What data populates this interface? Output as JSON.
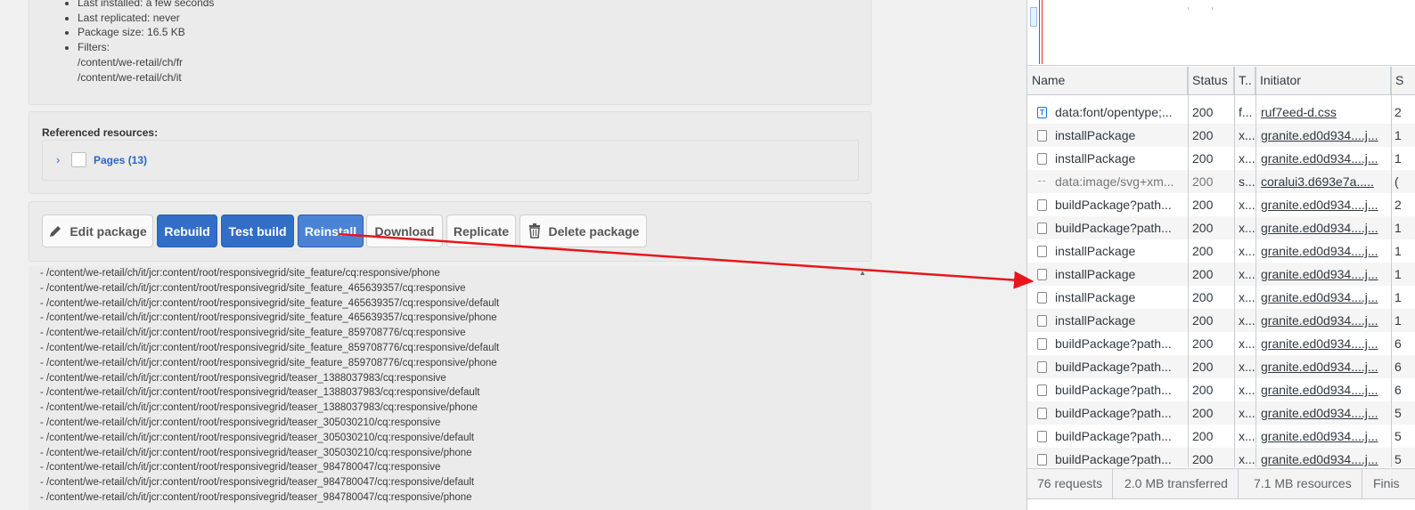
{
  "package_info": {
    "items": [
      "Last installed: a few seconds",
      "Last replicated: never",
      "Package size: 16.5 KB",
      "Filters:"
    ],
    "filters": [
      "/content/we-retail/ch/fr",
      "/content/we-retail/ch/it"
    ]
  },
  "references": {
    "title": "Referenced resources:",
    "pages_label": "Pages (13)"
  },
  "toolbar": {
    "edit": "Edit package",
    "rebuild": "Rebuild",
    "test_build": "Test build",
    "reinstall": "Reinstall",
    "download": "Download",
    "replicate": "Replicate",
    "delete": "Delete package"
  },
  "log_lines": [
    "- /content/we-retail/ch/it/jcr:content/root/responsivegrid/site_feature/cq:responsive/phone",
    "- /content/we-retail/ch/it/jcr:content/root/responsivegrid/site_feature_465639357/cq:responsive",
    "- /content/we-retail/ch/it/jcr:content/root/responsivegrid/site_feature_465639357/cq:responsive/default",
    "- /content/we-retail/ch/it/jcr:content/root/responsivegrid/site_feature_465639357/cq:responsive/phone",
    "- /content/we-retail/ch/it/jcr:content/root/responsivegrid/site_feature_859708776/cq:responsive",
    "- /content/we-retail/ch/it/jcr:content/root/responsivegrid/site_feature_859708776/cq:responsive/default",
    "- /content/we-retail/ch/it/jcr:content/root/responsivegrid/site_feature_859708776/cq:responsive/phone",
    "- /content/we-retail/ch/it/jcr:content/root/responsivegrid/teaser_1388037983/cq:responsive",
    "- /content/we-retail/ch/it/jcr:content/root/responsivegrid/teaser_1388037983/cq:responsive/default",
    "- /content/we-retail/ch/it/jcr:content/root/responsivegrid/teaser_1388037983/cq:responsive/phone",
    "- /content/we-retail/ch/it/jcr:content/root/responsivegrid/teaser_305030210/cq:responsive",
    "- /content/we-retail/ch/it/jcr:content/root/responsivegrid/teaser_305030210/cq:responsive/default",
    "- /content/we-retail/ch/it/jcr:content/root/responsivegrid/teaser_305030210/cq:responsive/phone",
    "- /content/we-retail/ch/it/jcr:content/root/responsivegrid/teaser_984780047/cq:responsive",
    "- /content/we-retail/ch/it/jcr:content/root/responsivegrid/teaser_984780047/cq:responsive/default",
    "- /content/we-retail/ch/it/jcr:content/root/responsivegrid/teaser_984780047/cq:responsive/phone"
  ],
  "network": {
    "columns": [
      "Name",
      "Status",
      "T..",
      "Initiator",
      "S"
    ],
    "rows": [
      {
        "icon": "font",
        "name": "data:font/opentype;...",
        "status": "200",
        "type": "f...",
        "initiator": "ruf7eed-d.css",
        "size": "2"
      },
      {
        "icon": "doc",
        "name": "installPackage",
        "status": "200",
        "type": "x...",
        "initiator": "granite.ed0d934....j...",
        "size": "1"
      },
      {
        "icon": "doc",
        "name": "installPackage",
        "status": "200",
        "type": "x...",
        "initiator": "granite.ed0d934....j...",
        "size": "1"
      },
      {
        "icon": "img",
        "name": "data:image/svg+xm...",
        "status": "200",
        "type": "s...",
        "initiator": "coralui3.d693e7a.....",
        "size": "("
      },
      {
        "icon": "doc",
        "name": "buildPackage?path...",
        "status": "200",
        "type": "x...",
        "initiator": "granite.ed0d934....j...",
        "size": "2"
      },
      {
        "icon": "doc",
        "name": "buildPackage?path...",
        "status": "200",
        "type": "x...",
        "initiator": "granite.ed0d934....j...",
        "size": "1"
      },
      {
        "icon": "doc",
        "name": "installPackage",
        "status": "200",
        "type": "x...",
        "initiator": "granite.ed0d934....j...",
        "size": "1"
      },
      {
        "icon": "doc",
        "name": "installPackage",
        "status": "200",
        "type": "x...",
        "initiator": "granite.ed0d934....j...",
        "size": "1"
      },
      {
        "icon": "doc",
        "name": "installPackage",
        "status": "200",
        "type": "x...",
        "initiator": "granite.ed0d934....j...",
        "size": "1"
      },
      {
        "icon": "doc",
        "name": "installPackage",
        "status": "200",
        "type": "x...",
        "initiator": "granite.ed0d934....j...",
        "size": "1"
      },
      {
        "icon": "doc",
        "name": "buildPackage?path...",
        "status": "200",
        "type": "x...",
        "initiator": "granite.ed0d934....j...",
        "size": "6"
      },
      {
        "icon": "doc",
        "name": "buildPackage?path...",
        "status": "200",
        "type": "x...",
        "initiator": "granite.ed0d934....j...",
        "size": "6"
      },
      {
        "icon": "doc",
        "name": "buildPackage?path...",
        "status": "200",
        "type": "x...",
        "initiator": "granite.ed0d934....j...",
        "size": "6"
      },
      {
        "icon": "doc",
        "name": "buildPackage?path...",
        "status": "200",
        "type": "x...",
        "initiator": "granite.ed0d934....j...",
        "size": "5"
      },
      {
        "icon": "doc",
        "name": "buildPackage?path...",
        "status": "200",
        "type": "x...",
        "initiator": "granite.ed0d934....j...",
        "size": "5"
      },
      {
        "icon": "doc",
        "name": "buildPackage?path...",
        "status": "200",
        "type": "x...",
        "initiator": "granite.ed0d934....j...",
        "size": "5"
      }
    ],
    "summary": {
      "requests": "76 requests",
      "transferred": "2.0 MB transferred",
      "resources": "7.1 MB resources",
      "finish": "Finis"
    }
  },
  "colors": {
    "primary_button": "#326ec8",
    "annotation_arrow": "#e8161a"
  }
}
